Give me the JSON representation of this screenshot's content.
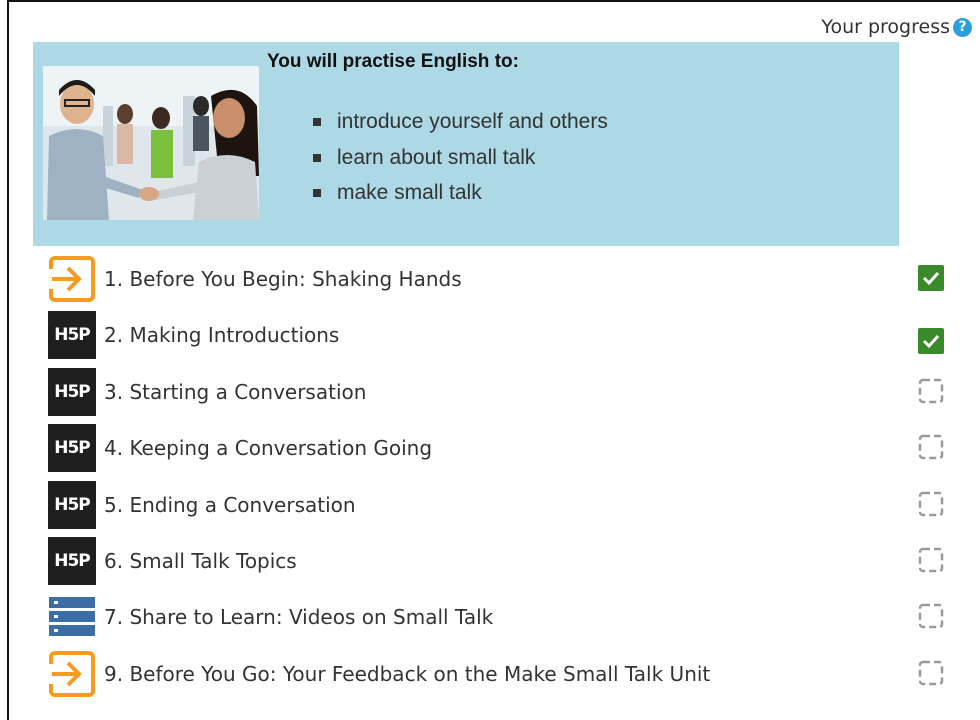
{
  "header": {
    "progress_label": "Your progress"
  },
  "intro": {
    "heading": "You will practise English to:",
    "items": [
      "introduce yourself and others",
      "learn about small talk",
      "make small talk"
    ]
  },
  "activities": [
    {
      "title": "1. Before You Begin: Shaking Hands",
      "icon": "orange-arrow-enter-icon",
      "completed": true
    },
    {
      "title": "2. Making Introductions",
      "icon": "h5p-icon",
      "completed": true
    },
    {
      "title": "3. Starting a Conversation",
      "icon": "h5p-icon",
      "completed": false
    },
    {
      "title": "4. Keeping a Conversation Going",
      "icon": "h5p-icon",
      "completed": false
    },
    {
      "title": "5. Ending a Conversation",
      "icon": "h5p-icon",
      "completed": false
    },
    {
      "title": "6. Small Talk Topics",
      "icon": "h5p-icon",
      "completed": false
    },
    {
      "title": "7. Share to Learn: Videos on Small Talk",
      "icon": "database-icon",
      "completed": false
    },
    {
      "title": "9. Before You Go: Your Feedback on the Make Small Talk Unit",
      "icon": "orange-arrow-enter-icon",
      "completed": false
    }
  ],
  "icons": {
    "h5p_text": "H5P"
  },
  "colors": {
    "intro_bg": "#add8e6",
    "check_done": "#3a8a2c",
    "accent_orange": "#f79a21",
    "db_blue": "#3a6ea5"
  }
}
